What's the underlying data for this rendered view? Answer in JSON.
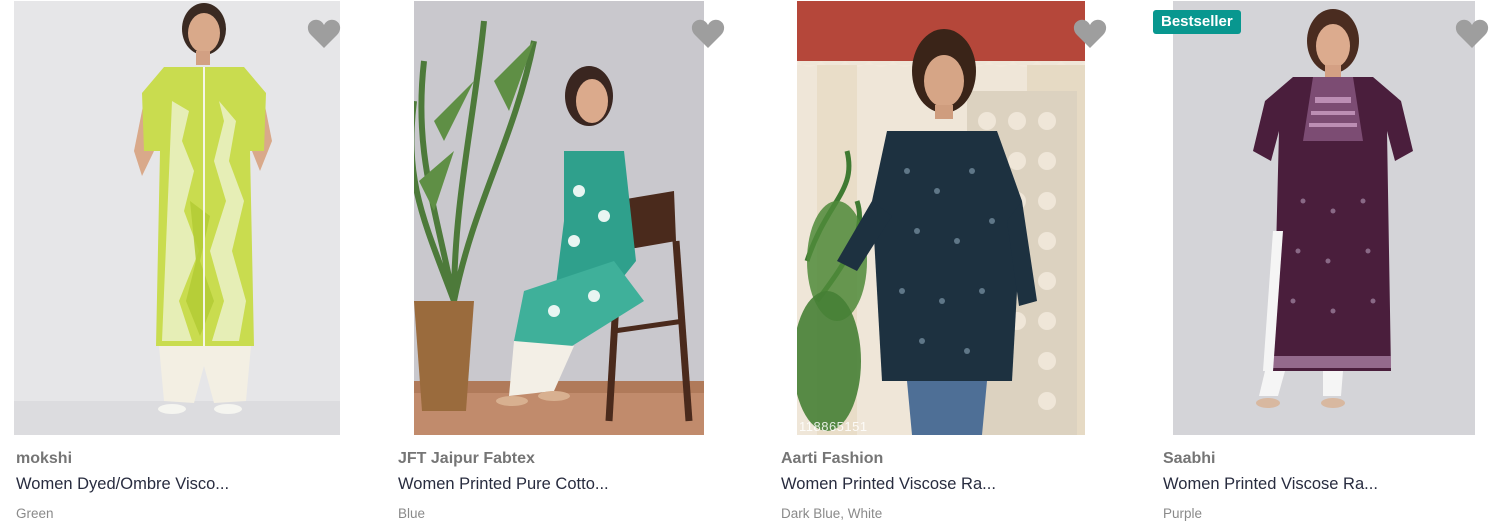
{
  "products": [
    {
      "brand": "mokshi",
      "title": "Women Dyed/Ombre Visco...",
      "color": "Green",
      "bestseller": false,
      "image_icon": "kurta-green-tie-dye-image",
      "accent": "#c2d845"
    },
    {
      "brand": "JFT Jaipur Fabtex",
      "title": "Women Printed Pure Cotto...",
      "color": "Blue",
      "bestseller": false,
      "image_icon": "kurta-teal-print-image",
      "accent": "#3aa58f"
    },
    {
      "brand": "Aarti Fashion",
      "title": "Women Printed Viscose Ra...",
      "color": "Dark Blue, White",
      "bestseller": false,
      "image_icon": "kurti-navy-print-image",
      "accent": "#1f3445",
      "watermark": "118865151"
    },
    {
      "brand": "Saabhi",
      "title": "Women Printed Viscose Ra...",
      "color": "Purple",
      "bestseller": true,
      "badge_label": "Bestseller",
      "image_icon": "kurta-purple-embroidered-image",
      "accent": "#4a1f3d"
    }
  ],
  "wishlist_icon": "heart-icon",
  "colors": {
    "badge": "#08978f",
    "heart": "#9e9e9e",
    "brand_text": "#757575",
    "title_text": "#282c3f",
    "meta_text": "#8a8a8a"
  }
}
